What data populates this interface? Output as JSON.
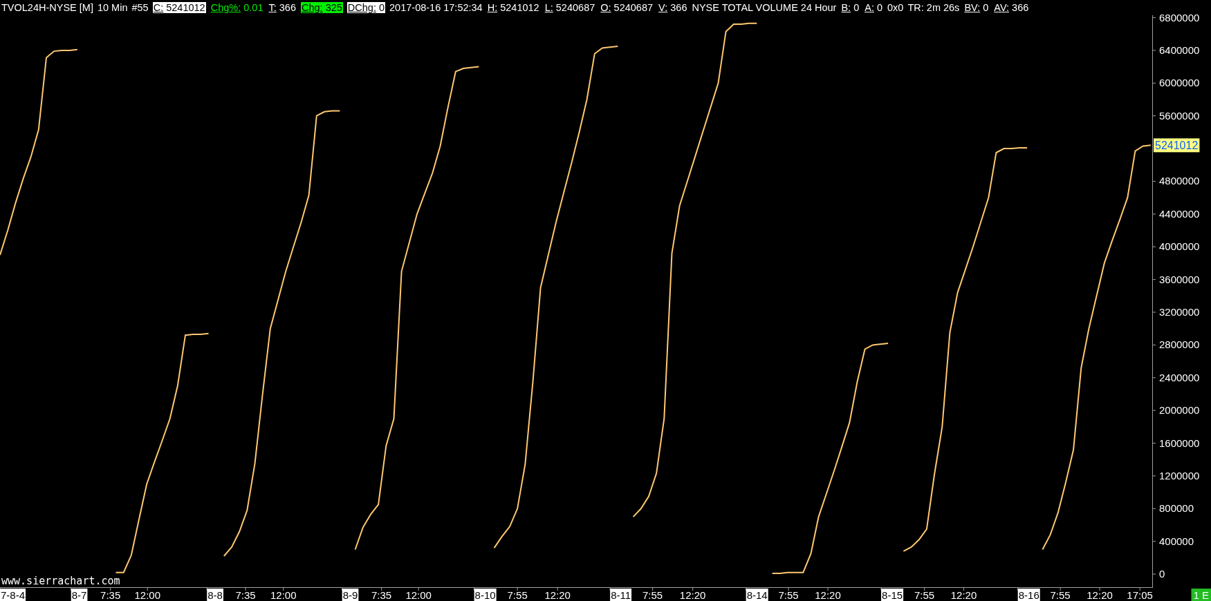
{
  "header": {
    "items": [
      {
        "kind": "plain",
        "text": "TVOL24H-NYSE [M]"
      },
      {
        "kind": "plain",
        "text": "10 Min"
      },
      {
        "kind": "plain",
        "text": "#55"
      },
      {
        "kind": "inverse-field",
        "label": "C:",
        "value": "5241012"
      },
      {
        "kind": "green-text-field",
        "label": "Chg%:",
        "value": "0.01"
      },
      {
        "kind": "field",
        "label": "T:",
        "value": "366"
      },
      {
        "kind": "green-fill-field",
        "label": "Chg:",
        "value": "325"
      },
      {
        "kind": "inverse-field",
        "label": "DChg:",
        "value": "0"
      },
      {
        "kind": "plain",
        "text": "2017-08-16 17:52:34"
      },
      {
        "kind": "field",
        "label": "H:",
        "value": "5241012"
      },
      {
        "kind": "field",
        "label": "L:",
        "value": "5240687"
      },
      {
        "kind": "field",
        "label": "O:",
        "value": "5240687"
      },
      {
        "kind": "field",
        "label": "V:",
        "value": "366"
      },
      {
        "kind": "plain",
        "text": "NYSE TOTAL VOLUME 24 Hour"
      },
      {
        "kind": "field",
        "label": "B:",
        "value": "0"
      },
      {
        "kind": "field",
        "label": "A:",
        "value": "0"
      },
      {
        "kind": "plain",
        "text": "0x0"
      },
      {
        "kind": "plain",
        "text": "TR: 2m 26s"
      },
      {
        "kind": "field",
        "label": "BV:",
        "value": "0"
      },
      {
        "kind": "field",
        "label": "AV:",
        "value": "366"
      }
    ]
  },
  "chart": {
    "chart_data": {
      "type": "line",
      "ylim": [
        -160000,
        6830000
      ],
      "yticks": [
        0,
        400000,
        800000,
        1200000,
        1600000,
        2000000,
        2400000,
        2800000,
        3200000,
        3600000,
        4000000,
        4400000,
        4800000,
        5600000,
        6000000,
        6400000,
        6800000
      ],
      "categories": [
        null,
        null,
        null,
        null,
        null,
        null,
        null,
        null,
        null,
        null,
        null,
        null,
        null,
        null,
        null,
        null,
        null,
        null,
        null,
        null,
        null,
        null,
        null,
        null,
        null,
        null,
        null,
        null,
        null,
        null,
        null,
        null,
        null,
        null,
        null,
        null,
        null,
        null,
        null,
        null,
        null,
        null,
        null,
        null,
        null,
        null,
        null,
        null,
        null,
        null,
        null,
        null,
        null,
        null,
        null,
        null,
        null,
        null,
        null,
        null,
        null,
        null,
        null,
        null,
        null,
        null,
        null,
        null,
        null,
        null,
        null,
        null,
        null,
        null,
        null,
        null,
        null,
        null,
        null,
        null,
        null,
        null,
        null,
        null,
        null,
        null,
        null,
        null,
        null,
        null,
        null,
        null,
        null,
        null,
        null,
        null,
        null,
        null,
        null,
        null,
        null,
        null,
        null,
        null,
        null,
        null,
        null,
        null,
        null,
        null,
        null,
        null,
        null,
        null,
        null,
        null,
        null,
        null,
        null,
        null,
        null,
        null,
        null,
        null,
        null,
        null,
        null,
        null,
        null,
        null,
        null,
        null,
        null,
        null,
        null,
        null,
        null,
        null,
        null,
        null,
        null,
        null,
        null,
        null,
        null,
        null,
        null,
        null,
        null,
        null
      ],
      "series": [
        {
          "color": "#ffc870",
          "values": [
            3900000,
            4200000,
            4530000,
            4830000,
            5100000,
            5430000,
            6310000,
            6390000,
            6400000,
            6400000,
            6410000,
            null,
            null,
            null,
            null,
            20000,
            20000,
            230000,
            670000,
            1100000,
            1370000,
            1630000,
            1900000,
            2300000,
            2920000,
            2930000,
            2930000,
            2940000,
            null,
            220000,
            330000,
            520000,
            780000,
            1350000,
            2200000,
            3000000,
            3350000,
            3700000,
            4000000,
            4300000,
            4630000,
            5600000,
            5650000,
            5660000,
            5660000,
            null,
            300000,
            570000,
            730000,
            850000,
            1570000,
            1900000,
            3700000,
            4050000,
            4400000,
            4650000,
            4900000,
            5230000,
            5700000,
            6140000,
            6180000,
            6190000,
            6200000,
            null,
            320000,
            460000,
            580000,
            800000,
            1340000,
            2350000,
            3500000,
            3900000,
            4300000,
            4660000,
            5020000,
            5400000,
            5800000,
            6360000,
            6430000,
            6440000,
            6450000,
            null,
            700000,
            800000,
            950000,
            1230000,
            1900000,
            3920000,
            4500000,
            4800000,
            5100000,
            5400000,
            5700000,
            6000000,
            6630000,
            6720000,
            6720000,
            6730000,
            6730000,
            null,
            10000,
            10000,
            20000,
            20000,
            20000,
            250000,
            700000,
            980000,
            1260000,
            1550000,
            1850000,
            2350000,
            2750000,
            2800000,
            2810000,
            2820000,
            null,
            280000,
            330000,
            420000,
            550000,
            1220000,
            1800000,
            2950000,
            3440000,
            3720000,
            4000000,
            4300000,
            4600000,
            5150000,
            5200000,
            5200000,
            5210000,
            5210000,
            null,
            300000,
            480000,
            750000,
            1120000,
            1520000,
            2520000,
            3000000,
            3400000,
            3800000,
            4070000,
            4330000,
            4600000,
            5170000,
            5230000,
            5240000
          ]
        }
      ]
    },
    "x_axis_labels": [
      {
        "kind": "date",
        "text": "7-8-4"
      },
      {
        "kind": "date",
        "text": "8-7"
      },
      {
        "kind": "time",
        "text": "7:35"
      },
      {
        "kind": "time",
        "text": "12:00"
      },
      {
        "kind": "date",
        "text": "8-8"
      },
      {
        "kind": "time",
        "text": "7:35"
      },
      {
        "kind": "time",
        "text": "12:00"
      },
      {
        "kind": "date",
        "text": "8-9"
      },
      {
        "kind": "time",
        "text": "7:35"
      },
      {
        "kind": "time",
        "text": "12:00"
      },
      {
        "kind": "date",
        "text": "8-10"
      },
      {
        "kind": "time",
        "text": "7:55"
      },
      {
        "kind": "time",
        "text": "12:20"
      },
      {
        "kind": "date",
        "text": "8-11"
      },
      {
        "kind": "time",
        "text": "7:55"
      },
      {
        "kind": "time",
        "text": "12:20"
      },
      {
        "kind": "date",
        "text": "8-14"
      },
      {
        "kind": "time",
        "text": "7:55"
      },
      {
        "kind": "time",
        "text": "12:20"
      },
      {
        "kind": "date",
        "text": "8-15"
      },
      {
        "kind": "time",
        "text": "7:55"
      },
      {
        "kind": "time",
        "text": "12:20"
      },
      {
        "kind": "date",
        "text": "8-16"
      },
      {
        "kind": "time",
        "text": "7:55"
      },
      {
        "kind": "time",
        "text": "12:20"
      },
      {
        "kind": "time",
        "text": "17:05"
      }
    ],
    "price_label": "5241012",
    "watermark": "www.sierrachart.com",
    "status_badge": "1 E"
  }
}
